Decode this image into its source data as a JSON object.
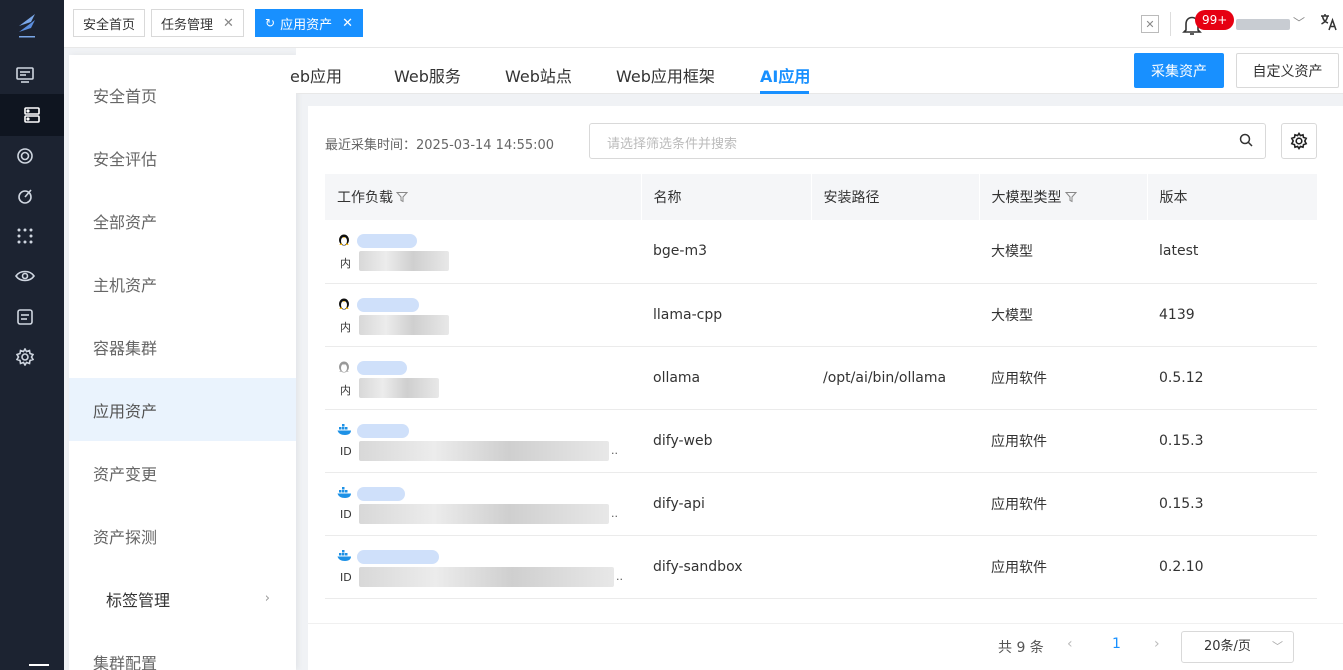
{
  "page_tabs": [
    {
      "label": "安全首页",
      "closable": false,
      "active": false
    },
    {
      "label": "任务管理",
      "closable": true,
      "active": false
    },
    {
      "label": "应用资产",
      "closable": true,
      "active": true
    }
  ],
  "header": {
    "notification_badge": "99+",
    "user_name_blurred": true
  },
  "left_menu": [
    {
      "label": "安全首页"
    },
    {
      "label": "安全评估"
    },
    {
      "label": "全部资产"
    },
    {
      "label": "主机资产"
    },
    {
      "label": "容器集群"
    },
    {
      "label": "应用资产",
      "active": true
    },
    {
      "label": "资产变更"
    },
    {
      "label": "资产探测"
    },
    {
      "label": "标签管理",
      "has_children": true
    },
    {
      "label": "集群配置"
    }
  ],
  "sub_tabs": [
    "eb应用",
    "Web服务",
    "Web站点",
    "Web应用框架",
    "AI应用"
  ],
  "active_sub_tab": "AI应用",
  "actions": {
    "collect": "采集资产",
    "custom": "自定义资产"
  },
  "last_collect": "最近采集时间：2025-03-14 14:55:00",
  "search": {
    "placeholder": "请选择筛选条件并搜索"
  },
  "table": {
    "columns": [
      "工作负载",
      "名称",
      "安装路径",
      "大模型类型",
      "版本"
    ],
    "rows": [
      {
        "os": "linux",
        "prefix": "内",
        "name": "bge-m3",
        "path": "",
        "type": "大模型",
        "version": "latest"
      },
      {
        "os": "linux",
        "prefix": "内",
        "name": "llama-cpp",
        "path": "",
        "type": "大模型",
        "version": "4139"
      },
      {
        "os": "linux-gray",
        "prefix": "内",
        "name": "ollama",
        "path": "/opt/ai/bin/ollama",
        "type": "应用软件",
        "version": "0.5.12"
      },
      {
        "os": "docker",
        "prefix": "ID",
        "name": "dify-web",
        "path": "",
        "type": "应用软件",
        "version": "0.15.3"
      },
      {
        "os": "docker",
        "prefix": "ID",
        "name": "dify-api",
        "path": "",
        "type": "应用软件",
        "version": "0.15.3"
      },
      {
        "os": "docker",
        "prefix": "ID",
        "name": "dify-sandbox",
        "path": "",
        "type": "应用软件",
        "version": "0.2.10"
      }
    ]
  },
  "pagination": {
    "total": "共 9 条",
    "current_page": "1",
    "page_size": "20条/页"
  },
  "colors": {
    "accent": "#1890ff",
    "rail": "#1c2331",
    "badge": "#e60012"
  }
}
